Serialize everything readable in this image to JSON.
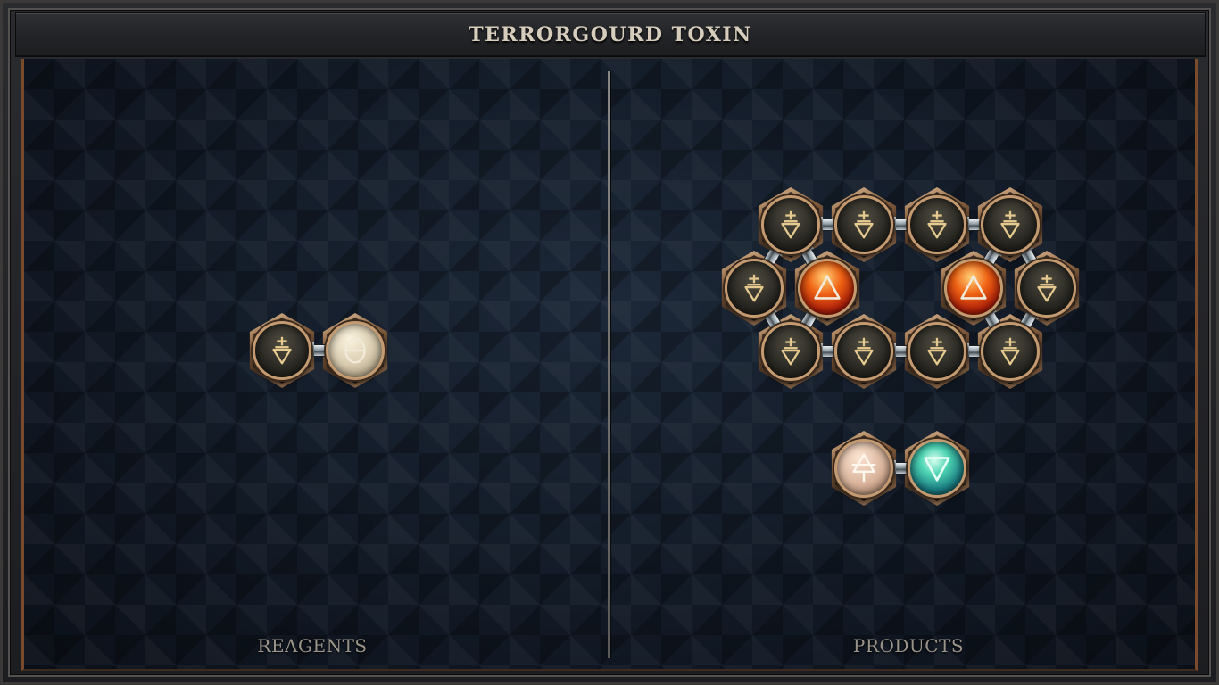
{
  "title": "TERRORGOURD TOXIN",
  "sections": {
    "reagents_label": "REAGENTS",
    "products_label": "PRODUCTS"
  },
  "colors": {
    "glyph_gold": "#e5c98e",
    "glyph_light": "#f2ead8",
    "glyph_dark": "#6e6452",
    "frame_copper": "#7a4a2c",
    "board_navy": "#141d29"
  },
  "reagents": {
    "molecule": {
      "atoms": [
        {
          "element": "salt",
          "style": "dark",
          "icon": "salt-symbol-icon"
        },
        {
          "element": "quintessence",
          "style": "pale",
          "icon": "theta-symbol-icon"
        }
      ],
      "bonds": [
        [
          0,
          1
        ]
      ]
    }
  },
  "products": {
    "molecules": [
      {
        "atoms": [
          {
            "element": "salt",
            "style": "dark",
            "icon": "salt-symbol-icon"
          },
          {
            "element": "salt",
            "style": "dark",
            "icon": "salt-symbol-icon"
          },
          {
            "element": "salt",
            "style": "dark",
            "icon": "salt-symbol-icon"
          },
          {
            "element": "salt",
            "style": "dark",
            "icon": "salt-symbol-icon"
          },
          {
            "element": "salt",
            "style": "dark",
            "icon": "salt-symbol-icon"
          },
          {
            "element": "fire",
            "style": "fire",
            "icon": "fire-triangle-icon"
          },
          {
            "element": "fire",
            "style": "fire",
            "icon": "fire-triangle-icon"
          },
          {
            "element": "salt",
            "style": "dark",
            "icon": "salt-symbol-icon"
          },
          {
            "element": "salt",
            "style": "dark",
            "icon": "salt-symbol-icon"
          },
          {
            "element": "salt",
            "style": "dark",
            "icon": "salt-symbol-icon"
          },
          {
            "element": "salt",
            "style": "dark",
            "icon": "salt-symbol-icon"
          },
          {
            "element": "salt",
            "style": "dark",
            "icon": "salt-symbol-icon"
          }
        ],
        "bonds": [
          [
            0,
            1
          ],
          [
            1,
            2
          ],
          [
            2,
            3
          ],
          [
            0,
            4
          ],
          [
            0,
            5
          ],
          [
            3,
            6
          ],
          [
            3,
            7
          ],
          [
            4,
            8
          ],
          [
            5,
            8
          ],
          [
            6,
            11
          ],
          [
            7,
            11
          ],
          [
            8,
            9
          ],
          [
            9,
            10
          ],
          [
            10,
            11
          ]
        ]
      },
      {
        "atoms": [
          {
            "element": "air",
            "style": "skin",
            "icon": "air-triangle-icon"
          },
          {
            "element": "water",
            "style": "water",
            "icon": "water-triangle-icon"
          }
        ],
        "bonds": [
          [
            0,
            1
          ]
        ]
      }
    ]
  }
}
